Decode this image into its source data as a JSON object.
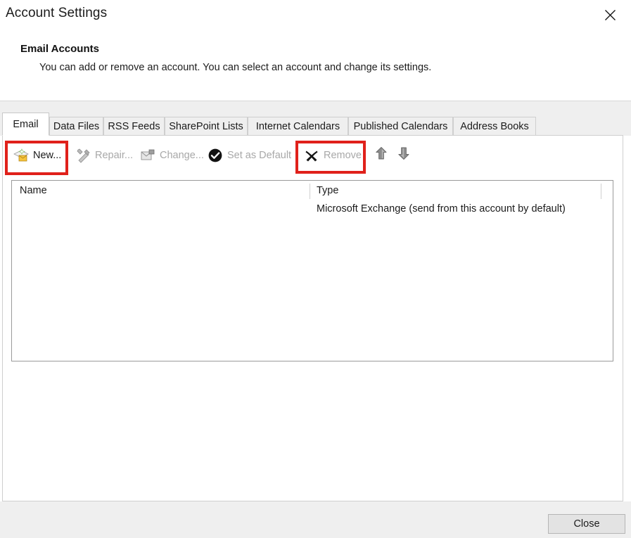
{
  "window": {
    "title": "Account Settings",
    "close_icon": "close-x-icon"
  },
  "header": {
    "heading": "Email Accounts",
    "description": "You can add or remove an account. You can select an account and change its settings."
  },
  "tabs": [
    {
      "label": "Email",
      "active": true
    },
    {
      "label": "Data Files",
      "active": false
    },
    {
      "label": "RSS Feeds",
      "active": false
    },
    {
      "label": "SharePoint Lists",
      "active": false
    },
    {
      "label": "Internet Calendars",
      "active": false
    },
    {
      "label": "Published Calendars",
      "active": false
    },
    {
      "label": "Address Books",
      "active": false
    }
  ],
  "toolbar": {
    "buttons": [
      {
        "label": "New...",
        "icon": "new-email-account-icon",
        "enabled": true,
        "highlighted": true
      },
      {
        "label": "Repair...",
        "icon": "repair-tools-icon",
        "enabled": false,
        "highlighted": false
      },
      {
        "label": "Change...",
        "icon": "change-account-icon",
        "enabled": false,
        "highlighted": false
      },
      {
        "label": "Set as Default",
        "icon": "check-circle-icon",
        "enabled": false,
        "highlighted": false
      },
      {
        "label": "Remove",
        "icon": "remove-x-icon",
        "enabled": false,
        "highlighted": true
      }
    ],
    "move_up": {
      "icon": "arrow-up-icon"
    },
    "move_down": {
      "icon": "arrow-down-icon"
    }
  },
  "account_list": {
    "columns": [
      "Name",
      "Type"
    ],
    "rows": [
      {
        "name": "",
        "type": "Microsoft Exchange (send from this account by default)"
      }
    ]
  },
  "footer": {
    "close_label": "Close"
  },
  "annotations": {
    "highlight_color": "#e0211b",
    "boxes": [
      "new-button-highlight",
      "remove-button-highlight"
    ]
  }
}
